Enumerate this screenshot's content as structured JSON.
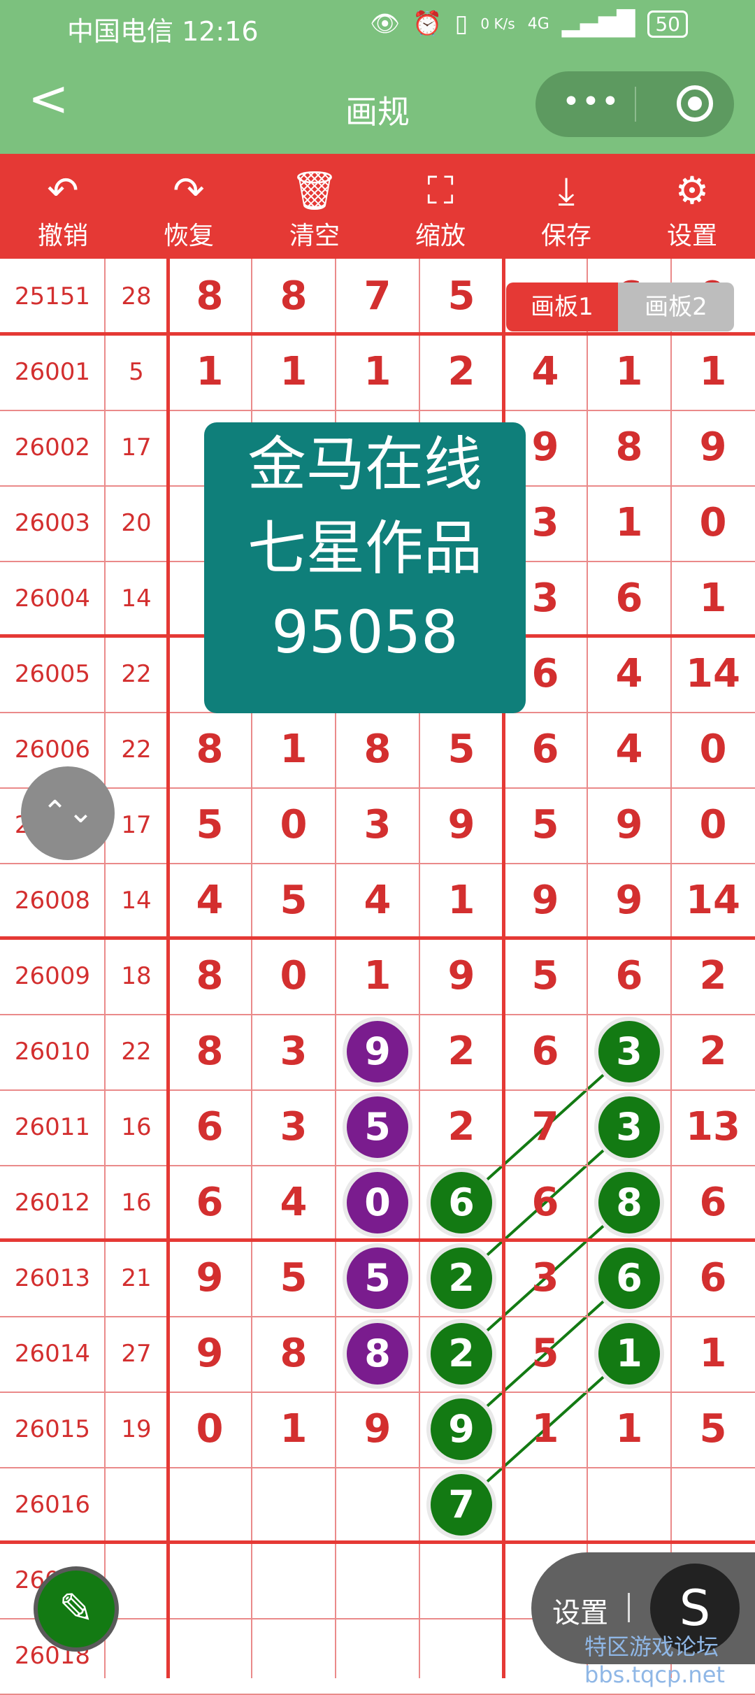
{
  "status": {
    "carrier": "中国电信 12:16",
    "net": "0 K/s",
    "signal": "4G",
    "battery": "50"
  },
  "nav": {
    "title": "画规",
    "back": "<",
    "more": "•••"
  },
  "toolbar": [
    {
      "label": "撤销",
      "icon": "undo-icon",
      "glyph": "↶"
    },
    {
      "label": "恢复",
      "icon": "redo-icon",
      "glyph": "↷"
    },
    {
      "label": "清空",
      "icon": "trash-icon",
      "glyph": "🗑"
    },
    {
      "label": "缩放",
      "icon": "zoom-icon",
      "glyph": "⛶"
    },
    {
      "label": "保存",
      "icon": "download-icon",
      "glyph": "⤓"
    },
    {
      "label": "设置",
      "icon": "gear-icon",
      "glyph": "⚙"
    }
  ],
  "tabs": {
    "board1": "画板1",
    "board2": "画板2"
  },
  "overlay": {
    "line1": "金马在线",
    "line2": "七星作品",
    "line3": "95058"
  },
  "rows": [
    {
      "id": "25151",
      "sum": "28",
      "nums": [
        "8",
        "8",
        "7",
        "5",
        "",
        "6",
        "9"
      ]
    },
    {
      "id": "26001",
      "sum": "5",
      "nums": [
        "1",
        "1",
        "1",
        "2",
        "4",
        "1",
        "1"
      ]
    },
    {
      "id": "26002",
      "sum": "17",
      "nums": [
        "",
        "",
        "",
        "",
        "9",
        "8",
        "9"
      ]
    },
    {
      "id": "26003",
      "sum": "20",
      "nums": [
        "",
        "",
        "",
        "",
        "3",
        "1",
        "0"
      ]
    },
    {
      "id": "26004",
      "sum": "14",
      "nums": [
        "",
        "",
        "",
        "",
        "3",
        "6",
        "1"
      ]
    },
    {
      "id": "26005",
      "sum": "22",
      "nums": [
        "",
        "",
        "",
        "",
        "6",
        "4",
        "14"
      ]
    },
    {
      "id": "26006",
      "sum": "22",
      "nums": [
        "8",
        "1",
        "8",
        "5",
        "6",
        "4",
        "0"
      ]
    },
    {
      "id": "26007",
      "sum": "17",
      "nums": [
        "5",
        "0",
        "3",
        "9",
        "5",
        "9",
        "0"
      ]
    },
    {
      "id": "26008",
      "sum": "14",
      "nums": [
        "4",
        "5",
        "4",
        "1",
        "9",
        "9",
        "14"
      ]
    },
    {
      "id": "26009",
      "sum": "18",
      "nums": [
        "8",
        "0",
        "1",
        "9",
        "5",
        "6",
        "2"
      ]
    },
    {
      "id": "26010",
      "sum": "22",
      "nums": [
        "8",
        "3",
        "",
        "2",
        "6",
        "",
        "2"
      ]
    },
    {
      "id": "26011",
      "sum": "16",
      "nums": [
        "6",
        "3",
        "",
        "2",
        "7",
        "",
        "13"
      ]
    },
    {
      "id": "26012",
      "sum": "16",
      "nums": [
        "6",
        "4",
        "",
        "",
        "6",
        "",
        "6"
      ]
    },
    {
      "id": "26013",
      "sum": "21",
      "nums": [
        "9",
        "5",
        "",
        "",
        "3",
        "",
        "6"
      ]
    },
    {
      "id": "26014",
      "sum": "27",
      "nums": [
        "9",
        "8",
        "",
        "",
        "5",
        "",
        "1"
      ]
    },
    {
      "id": "26015",
      "sum": "19",
      "nums": [
        "0",
        "1",
        "9",
        "",
        "1",
        "1",
        "5"
      ]
    },
    {
      "id": "26016",
      "sum": "",
      "nums": [
        "",
        "",
        "",
        "",
        "",
        "",
        ""
      ]
    },
    {
      "id": "26017",
      "sum": "",
      "nums": [
        "",
        "",
        "",
        "",
        "",
        "",
        ""
      ]
    },
    {
      "id": "26018",
      "sum": "",
      "nums": [
        "",
        "",
        "",
        "",
        "",
        "",
        ""
      ]
    }
  ],
  "circles": [
    {
      "row": 10,
      "col": 2,
      "value": "9",
      "color": "purple"
    },
    {
      "row": 11,
      "col": 2,
      "value": "5",
      "color": "purple"
    },
    {
      "row": 12,
      "col": 2,
      "value": "0",
      "color": "purple"
    },
    {
      "row": 13,
      "col": 2,
      "value": "5",
      "color": "purple"
    },
    {
      "row": 14,
      "col": 2,
      "value": "8",
      "color": "purple"
    },
    {
      "row": 12,
      "col": 3,
      "value": "6",
      "color": "green"
    },
    {
      "row": 13,
      "col": 3,
      "value": "2",
      "color": "green"
    },
    {
      "row": 14,
      "col": 3,
      "value": "2",
      "color": "green"
    },
    {
      "row": 15,
      "col": 3,
      "value": "9",
      "color": "green"
    },
    {
      "row": 16,
      "col": 3,
      "value": "7",
      "color": "green"
    },
    {
      "row": 10,
      "col": 5,
      "value": "3",
      "color": "green"
    },
    {
      "row": 11,
      "col": 5,
      "value": "3",
      "color": "green"
    },
    {
      "row": 12,
      "col": 5,
      "value": "8",
      "color": "green"
    },
    {
      "row": 13,
      "col": 5,
      "value": "6",
      "color": "green"
    },
    {
      "row": 14,
      "col": 5,
      "value": "1",
      "color": "green"
    }
  ],
  "links": [
    {
      "from_row": 12,
      "from_col": 3,
      "to_row": 10,
      "to_col": 5
    },
    {
      "from_row": 13,
      "from_col": 3,
      "to_row": 11,
      "to_col": 5
    },
    {
      "from_row": 14,
      "from_col": 3,
      "to_row": 12,
      "to_col": 5
    },
    {
      "from_row": 15,
      "from_col": 3,
      "to_row": 13,
      "to_col": 5
    },
    {
      "from_row": 16,
      "from_col": 3,
      "to_row": 14,
      "to_col": 5
    }
  ],
  "colors": {
    "header_green": "#7cc17e",
    "toolbar_red": "#e53935",
    "text_red": "#d32f2f",
    "overlay_teal": "#0f7f7a",
    "circle_purple": "#7a1c8e",
    "circle_green": "#137a13"
  },
  "float": {
    "settings_label": "设置",
    "s_button": "S",
    "scroll_glyph": "⌃⌄",
    "pen_glyph": "✎"
  },
  "watermark": "特区游戏论坛 bbs.tqcp.net"
}
